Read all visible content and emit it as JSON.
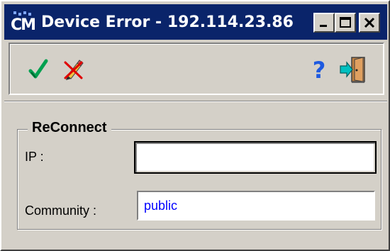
{
  "window": {
    "title": "Device Error - 192.114.23.86",
    "app_icon": "cm-app-icon",
    "title_color": "#0a246a"
  },
  "titlebar_buttons": {
    "minimize_icon": "minimize-icon",
    "maximize_icon": "maximize-icon",
    "close_icon": "close-icon"
  },
  "toolbar": {
    "ok_icon": "checkmark-icon",
    "cancel_icon": "pencil-cross-icon",
    "help_icon": "question-mark-icon",
    "exit_icon": "exit-door-icon"
  },
  "group": {
    "title": "ReConnect"
  },
  "form": {
    "ip_label": "IP :",
    "ip_value": "",
    "community_label": "Community :",
    "community_value": "public"
  }
}
